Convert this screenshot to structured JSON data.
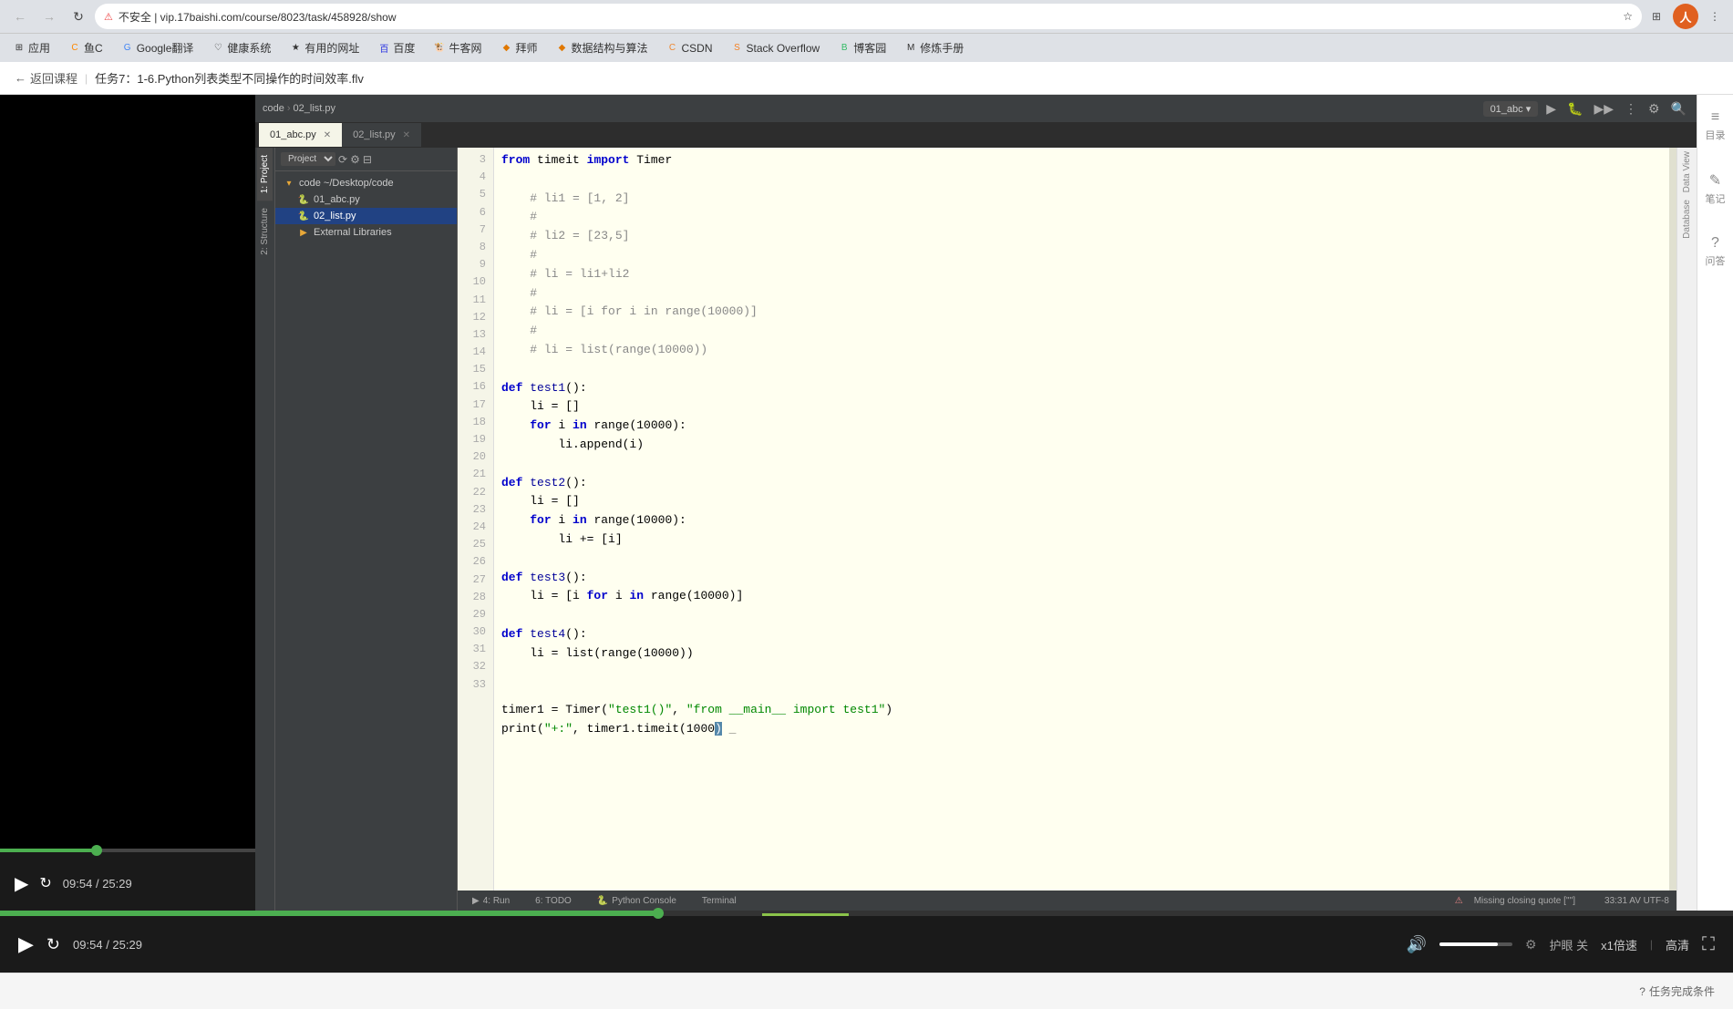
{
  "browser": {
    "url": "不安全 | vip.17baishi.com/course/8023/task/458928/show",
    "back_disabled": false,
    "forward_disabled": false
  },
  "bookmarks": [
    {
      "label": "应用",
      "icon": "⊞"
    },
    {
      "label": "鱼C",
      "icon": "🐟"
    },
    {
      "label": "Google翻译",
      "icon": "G"
    },
    {
      "label": "健康系统",
      "icon": "♡"
    },
    {
      "label": "有用的网址",
      "icon": "★"
    },
    {
      "label": "百度",
      "icon": "百"
    },
    {
      "label": "牛客网",
      "icon": "🐮"
    },
    {
      "label": "拜师",
      "icon": "◆"
    },
    {
      "label": "数据结构与算法",
      "icon": "◆"
    },
    {
      "label": "CSDN",
      "icon": "C"
    },
    {
      "label": "Stack Overflow",
      "icon": "S"
    },
    {
      "label": "博客园",
      "icon": "B"
    },
    {
      "label": "修炼手册",
      "icon": "M"
    }
  ],
  "page": {
    "back_label": "返回课程",
    "task_title": "任务7：1-6.Python列表类型不同操作的时间效率.flv"
  },
  "ide": {
    "breadcrumb": [
      "code",
      "02_list.py"
    ],
    "run_config": "01_abc",
    "tabs": [
      {
        "label": "01_abc.py",
        "active": true
      },
      {
        "label": "02_list.py",
        "active": false
      }
    ],
    "project": {
      "root": "code ~/Desktop/code",
      "items": [
        {
          "name": "code",
          "type": "folder",
          "level": 0
        },
        {
          "name": "01_abc.py",
          "type": "py",
          "level": 1
        },
        {
          "name": "02_list.py",
          "type": "py",
          "level": 1,
          "selected": true
        },
        {
          "name": "External Libraries",
          "type": "folder",
          "level": 1
        }
      ]
    },
    "side_tabs": [
      "1: Project",
      "2: Structure"
    ],
    "code_lines": [
      {
        "num": 3,
        "text": "from timeit import Timer",
        "tokens": [
          {
            "t": "from",
            "c": "kw"
          },
          {
            "t": " timeit ",
            "c": ""
          },
          {
            "t": "import",
            "c": "kw"
          },
          {
            "t": " Timer",
            "c": ""
          }
        ]
      },
      {
        "num": 4,
        "text": ""
      },
      {
        "num": 5,
        "text": "    # li1 = [1, 2]",
        "tokens": [
          {
            "t": "    # li1 = [1, 2]",
            "c": "cm"
          }
        ]
      },
      {
        "num": 6,
        "text": "    #",
        "tokens": [
          {
            "t": "    #",
            "c": "cm"
          }
        ]
      },
      {
        "num": 7,
        "text": "    # li2 = [23,5]",
        "tokens": [
          {
            "t": "    # li2 = [23,5]",
            "c": "cm"
          }
        ]
      },
      {
        "num": 8,
        "text": "    #",
        "tokens": [
          {
            "t": "    #",
            "c": "cm"
          }
        ]
      },
      {
        "num": 9,
        "text": "    # li = li1+li2",
        "tokens": [
          {
            "t": "    # li = li1+li2",
            "c": "cm"
          }
        ]
      },
      {
        "num": 10,
        "text": "    #",
        "tokens": [
          {
            "t": "    #",
            "c": "cm"
          }
        ]
      },
      {
        "num": 11,
        "text": "    # li = [i for i in range(10000)]",
        "tokens": [
          {
            "t": "    # li = [i for i in range(10000)]",
            "c": "cm"
          }
        ]
      },
      {
        "num": 12,
        "text": "    #",
        "tokens": [
          {
            "t": "    #",
            "c": "cm"
          }
        ]
      },
      {
        "num": 13,
        "text": "    # li = list(range(10000))",
        "tokens": [
          {
            "t": "    # li = list(range(10000))",
            "c": "cm"
          }
        ]
      },
      {
        "num": 14,
        "text": ""
      },
      {
        "num": 15,
        "text": "def test1():",
        "tokens": [
          {
            "t": "def",
            "c": "kw"
          },
          {
            "t": " test1():",
            "c": ""
          }
        ]
      },
      {
        "num": 16,
        "text": "    li = []",
        "tokens": [
          {
            "t": "    li = []",
            "c": ""
          }
        ]
      },
      {
        "num": 17,
        "text": "    for i in range(10000):",
        "tokens": [
          {
            "t": "    "
          },
          {
            "t": "for",
            "c": "kw"
          },
          {
            "t": " i "
          },
          {
            "t": "in",
            "c": "kw"
          },
          {
            "t": " range(10000):"
          }
        ]
      },
      {
        "num": 18,
        "text": "        li.append(i)",
        "tokens": [
          {
            "t": "        li.append(i)",
            "c": ""
          }
        ]
      },
      {
        "num": 19,
        "text": ""
      },
      {
        "num": 20,
        "text": "def test2():",
        "tokens": [
          {
            "t": "def",
            "c": "kw"
          },
          {
            "t": " test2():",
            "c": ""
          }
        ]
      },
      {
        "num": 21,
        "text": "    li = []",
        "tokens": [
          {
            "t": "    li = []",
            "c": ""
          }
        ]
      },
      {
        "num": 22,
        "text": "    for i in range(10000):",
        "tokens": [
          {
            "t": "    "
          },
          {
            "t": "for",
            "c": "kw"
          },
          {
            "t": " i "
          },
          {
            "t": "in",
            "c": "kw"
          },
          {
            "t": " range(10000):"
          }
        ]
      },
      {
        "num": 23,
        "text": "        li += [i]",
        "tokens": [
          {
            "t": "        li += [i]",
            "c": ""
          }
        ]
      },
      {
        "num": 24,
        "text": ""
      },
      {
        "num": 25,
        "text": "def test3():",
        "tokens": [
          {
            "t": "def",
            "c": "kw"
          },
          {
            "t": " test3():",
            "c": ""
          }
        ]
      },
      {
        "num": 26,
        "text": "    li = [i for i in range(10000)]",
        "tokens": [
          {
            "t": "    li = [i "
          },
          {
            "t": "for",
            "c": "kw"
          },
          {
            "t": " i "
          },
          {
            "t": "in",
            "c": "kw"
          },
          {
            "t": " range(10000)]"
          }
        ]
      },
      {
        "num": 27,
        "text": ""
      },
      {
        "num": 28,
        "text": "def test4():",
        "tokens": [
          {
            "t": "def",
            "c": "kw"
          },
          {
            "t": " test4():",
            "c": ""
          }
        ]
      },
      {
        "num": 29,
        "text": "    li = list(range(10000))",
        "tokens": [
          {
            "t": "    li = list(range(10000))",
            "c": ""
          }
        ]
      },
      {
        "num": 30,
        "text": ""
      },
      {
        "num": 31,
        "text": ""
      },
      {
        "num": 32,
        "text": "timer1 = Timer(\"test1()\", \"from __main__ import test1\")",
        "tokens": [
          {
            "t": "timer1 = Timer("
          },
          {
            "t": "\"test1()\"",
            "c": "str"
          },
          {
            "t": ", "
          },
          {
            "t": "\"from __main__ import test1\"",
            "c": "str"
          },
          {
            "t": ")"
          }
        ]
      },
      {
        "num": 33,
        "text": "print(\"+:\", timer1.timeit(1000)",
        "tokens": [
          {
            "t": "print("
          },
          {
            "t": "\"+:\"",
            "c": "str"
          },
          {
            "t": ", timer1.timeit(1000)"
          }
        ]
      }
    ],
    "bottom_tabs": [
      "4: Run",
      "6: TODO",
      "Python Console",
      "Terminal"
    ],
    "status_bar": "Missing closing quote ['\"']",
    "status_right": "33:31  AV  UTF-8"
  },
  "video": {
    "current_time": "09:54",
    "total_time": "25:29",
    "progress_percent": 38,
    "volume_percent": 80,
    "eye_protection": "护眼 关",
    "speed": "x1倍速",
    "separator": "|",
    "quality": "高清",
    "fullscreen_icon": "⛶"
  },
  "right_panel": [
    {
      "label": "目录",
      "icon": "≡"
    },
    {
      "label": "笔记",
      "icon": "✎"
    },
    {
      "label": "问答",
      "icon": "?"
    }
  ],
  "footer": {
    "task_condition": "任务完成条件"
  }
}
